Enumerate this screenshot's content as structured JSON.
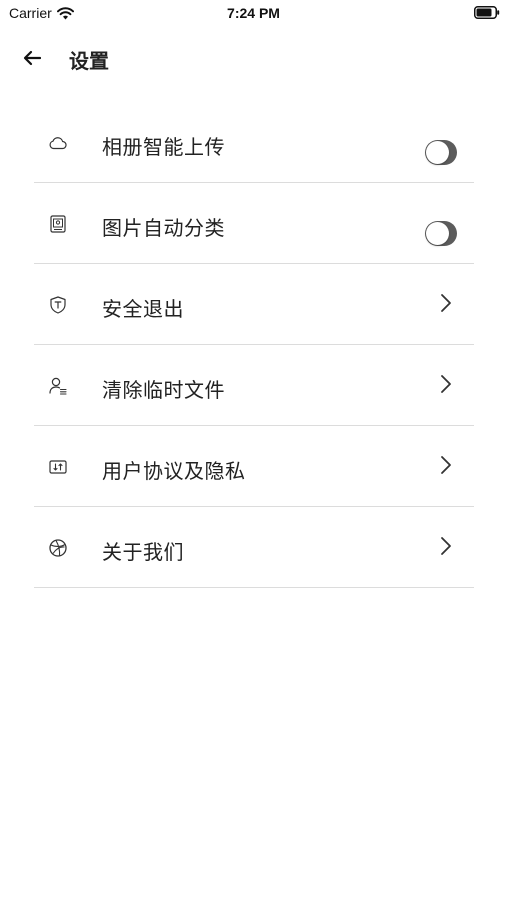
{
  "status_bar": {
    "carrier": "Carrier",
    "time": "7:24 PM"
  },
  "nav": {
    "title": "设置"
  },
  "settings": {
    "items": [
      {
        "label": "相册智能上传",
        "icon": "cloud-icon",
        "control": "toggle",
        "enabled": false
      },
      {
        "label": "图片自动分类",
        "icon": "photo-frame-icon",
        "control": "toggle",
        "enabled": false
      },
      {
        "label": "安全退出",
        "icon": "shield-icon",
        "control": "chevron"
      },
      {
        "label": "清除临时文件",
        "icon": "user-list-icon",
        "control": "chevron"
      },
      {
        "label": "用户协议及隐私",
        "icon": "document-icon",
        "control": "chevron"
      },
      {
        "label": "关于我们",
        "icon": "globe-icon",
        "control": "chevron"
      }
    ]
  },
  "colors": {
    "toggle_track": "#5c5c5c",
    "divider": "#dcdcdc",
    "text": "#222222"
  }
}
